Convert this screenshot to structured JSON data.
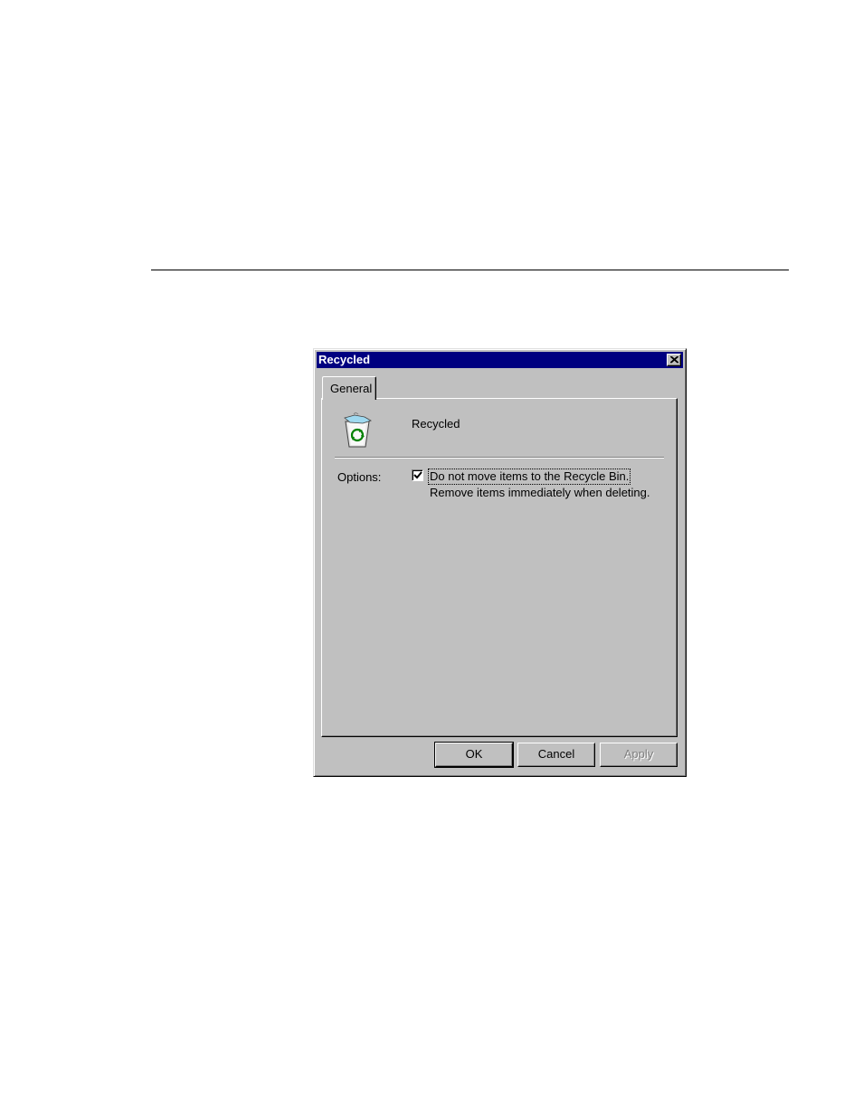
{
  "dialog": {
    "title": "Recycled",
    "close_glyph": "close-icon"
  },
  "tabs": [
    {
      "label": "General",
      "selected": true
    }
  ],
  "general": {
    "icon": "recycle-bin-icon",
    "folder_name": "Recycled",
    "options_label": "Options:",
    "checkbox": {
      "checked": true,
      "label": "Do not move items to the Recycle Bin.",
      "description": "Remove items immediately when deleting."
    }
  },
  "buttons": {
    "ok": "OK",
    "cancel": "Cancel",
    "apply": "Apply",
    "apply_enabled": false
  },
  "colors": {
    "titlebar": "#000080",
    "face": "#c0c0c0"
  }
}
